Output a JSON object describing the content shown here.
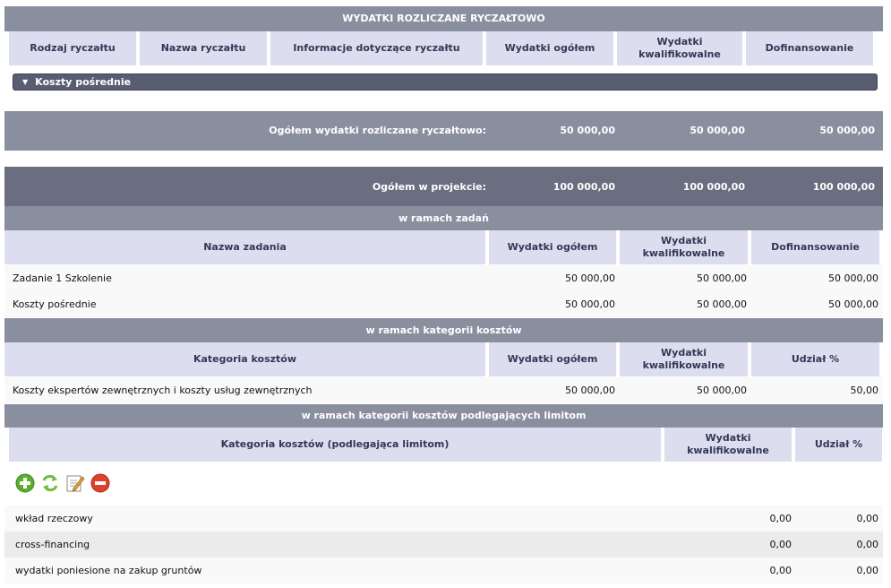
{
  "sections": {
    "ryczalt_title": "WYDATKI ROZLICZANE RYCZAŁTOWO",
    "zadania_title": "w ramach zadań",
    "kategorie_title": "w ramach kategorii kosztów",
    "limity_title": "w ramach kategorii kosztów podlegających limitom"
  },
  "ryczalt_headers": {
    "rodzaj": "Rodzaj ryczałtu",
    "nazwa": "Nazwa ryczałtu",
    "informacje": "Informacje dotyczące ryczałtu",
    "wydatki_ogolem": "Wydatki ogółem",
    "wydatki_kwal": "Wydatki kwalifikowalne",
    "dofinansowanie": "Dofinansowanie"
  },
  "collapsible": {
    "label": "Koszty pośrednie"
  },
  "summary_ryczalt": {
    "label": "Ogółem wydatki rozliczane ryczałtowo:",
    "ogolem": "50 000,00",
    "kwal": "50 000,00",
    "dofin": "50 000,00"
  },
  "summary_projekt": {
    "label": "Ogółem w projekcie:",
    "ogolem": "100 000,00",
    "kwal": "100 000,00",
    "dofin": "100 000,00"
  },
  "zadania_headers": {
    "nazwa": "Nazwa zadania",
    "ogolem": "Wydatki ogółem",
    "kwal": "Wydatki kwalifikowalne",
    "dofin": "Dofinansowanie"
  },
  "zadania_rows": [
    {
      "nazwa": "Zadanie 1 Szkolenie",
      "ogolem": "50 000,00",
      "kwal": "50 000,00",
      "dofin": "50 000,00"
    },
    {
      "nazwa": "Koszty pośrednie",
      "ogolem": "50 000,00",
      "kwal": "50 000,00",
      "dofin": "50 000,00"
    }
  ],
  "kategorie_headers": {
    "kategoria": "Kategoria kosztów",
    "ogolem": "Wydatki ogółem",
    "kwal": "Wydatki kwalifikowalne",
    "udzial": "Udział %"
  },
  "kategorie_rows": [
    {
      "kategoria": "Koszty ekspertów zewnętrznych i koszty usług zewnętrznych",
      "ogolem": "50 000,00",
      "kwal": "50 000,00",
      "udzial": "50,00"
    }
  ],
  "limity_headers": {
    "kategoria": "Kategoria kosztów (podlegająca limitom)",
    "kwal": "Wydatki kwalifikowalne",
    "udzial": "Udział %"
  },
  "toolbar_icons": [
    "add-icon",
    "refresh-icon",
    "edit-icon",
    "delete-icon"
  ],
  "limity_rows": [
    {
      "kategoria": "wkład rzeczowy",
      "kwal": "0,00",
      "udzial": "0,00"
    },
    {
      "kategoria": "cross-financing",
      "kwal": "0,00",
      "udzial": "0,00"
    },
    {
      "kategoria": "wydatki poniesione na zakup gruntów",
      "kwal": "0,00",
      "udzial": "0,00"
    }
  ],
  "colors": {
    "section_bar": "#8a8fa0",
    "summary_dark": "#6a6e80",
    "header_cell": "#dcdeef",
    "stripe": "#ebebeb"
  }
}
